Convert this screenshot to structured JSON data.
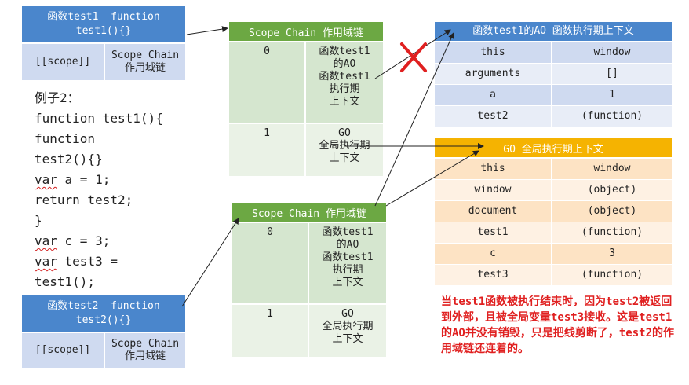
{
  "test1_box": {
    "header": "函数test1  function test1(){}",
    "scope_label": "[[scope]]",
    "chain_label": "Scope Chain\n作用域链"
  },
  "test2_box": {
    "header": "函数test2  function test2(){}",
    "scope_label": "[[scope]]",
    "chain_label": "Scope Chain\n作用域链"
  },
  "code": {
    "title": "例子2：",
    "lines": [
      {
        "text": "function test1(){"
      },
      {
        "text": "  function"
      },
      {
        "text": "test2(){}"
      },
      {
        "pre": "  ",
        "kw": "var",
        "text": " a = 1;"
      },
      {
        "text": "  return test2;"
      },
      {
        "text": "}"
      },
      {
        "kw": "var",
        "text": " c = 3;"
      },
      {
        "kw": "var",
        "text": " test3 ="
      },
      {
        "text": "test1();"
      }
    ]
  },
  "scope_chain_1": {
    "header": "Scope Chain 作用域链",
    "rows": [
      {
        "index": "0",
        "value": "函数test1\n的AO\n函数test1\n执行期\n上下文"
      },
      {
        "index": "1",
        "value": "GO\n全局执行期\n上下文"
      }
    ]
  },
  "scope_chain_2": {
    "header": "Scope Chain 作用域链",
    "rows": [
      {
        "index": "0",
        "value": "函数test1\n的AO\n函数test1\n执行期\n上下文"
      },
      {
        "index": "1",
        "value": "GO\n全局执行期\n上下文"
      }
    ]
  },
  "ao_table": {
    "header": "函数test1的AO 函数执行期上下文",
    "rows": [
      {
        "key": "this",
        "value": "window"
      },
      {
        "key": "arguments",
        "value": "[]"
      },
      {
        "key": "a",
        "value": "1"
      },
      {
        "key": "test2",
        "value": "(function)"
      }
    ]
  },
  "go_table": {
    "header": "GO 全局执行期上下文",
    "rows": [
      {
        "key": "this",
        "value": "window"
      },
      {
        "key": "window",
        "value": "(object)"
      },
      {
        "key": "document",
        "value": "(object)"
      },
      {
        "key": "test1",
        "value": "(function)"
      },
      {
        "key": "c",
        "value": "3"
      },
      {
        "key": "test3",
        "value": "(function)"
      }
    ]
  },
  "note": "当test1函数被执行结束时，因为test2被返回到外部，且被全局变量test3接收。这是test1的AO并没有销毁，只是把线剪断了，test2的作用域链还连着的。",
  "colors": {
    "blue_header": "#4a86cc",
    "green_header": "#6ca843",
    "orange_header": "#f5b301",
    "cross": "#e02020",
    "note": "#e02020"
  },
  "icons": {
    "cross": "red-cross-icon"
  }
}
